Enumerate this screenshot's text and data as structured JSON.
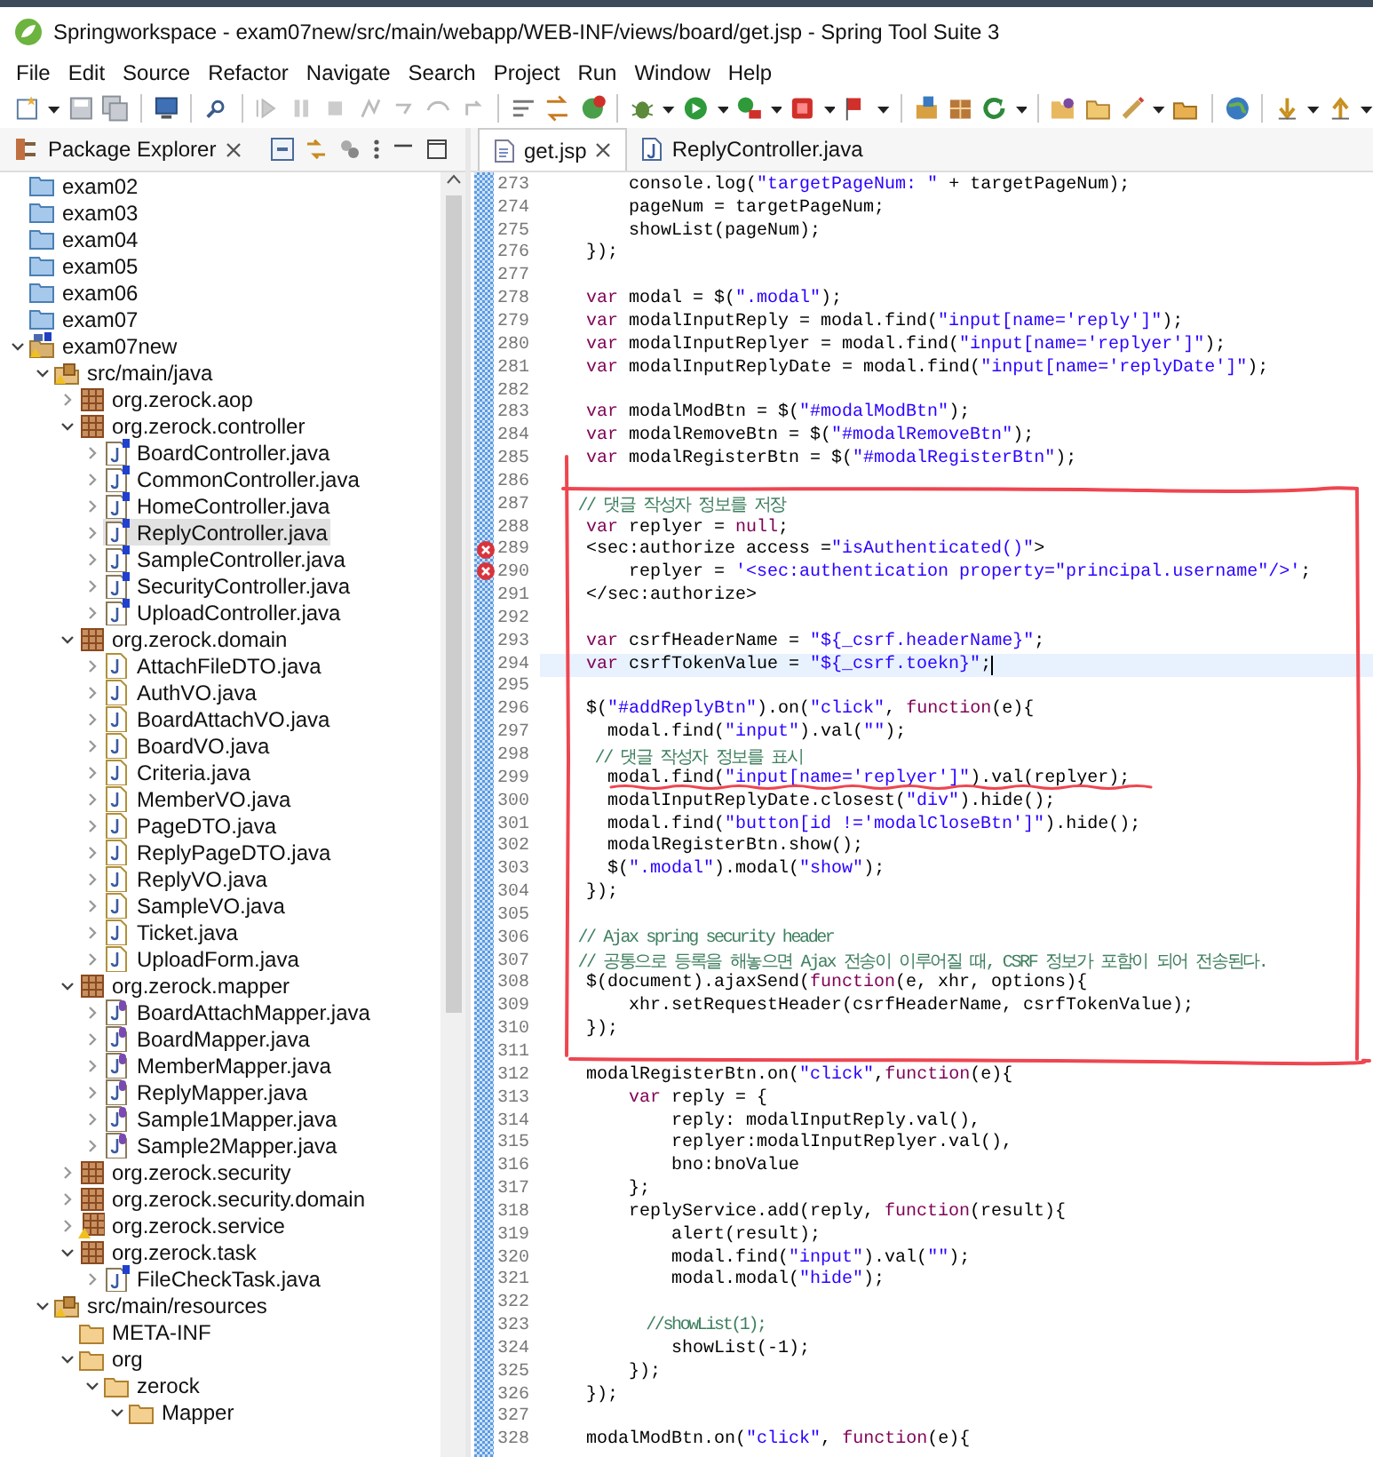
{
  "window": {
    "title": "Springworkspace - exam07new/src/main/webapp/WEB-INF/views/board/get.jsp - Spring Tool Suite 3"
  },
  "menu": [
    "File",
    "Edit",
    "Source",
    "Refactor",
    "Navigate",
    "Search",
    "Project",
    "Run",
    "Window",
    "Help"
  ],
  "explorer": {
    "title": "Package Explorer",
    "items": [
      {
        "label": "exam02",
        "kind": "project",
        "selected": false
      },
      {
        "label": "exam03",
        "kind": "project",
        "selected": false
      },
      {
        "label": "exam04",
        "kind": "project",
        "selected": false
      },
      {
        "label": "exam05",
        "kind": "project",
        "selected": false
      },
      {
        "label": "exam06",
        "kind": "project",
        "selected": false
      },
      {
        "label": "exam07",
        "kind": "project",
        "selected": false
      },
      {
        "label": "exam07new",
        "kind": "spring-project",
        "selected": false,
        "expanded": true,
        "children": [
          {
            "label": "src/main/java",
            "kind": "source-folder",
            "selected": false,
            "expanded": true,
            "children": [
              {
                "label": "org.zerock.aop",
                "kind": "package",
                "selected": false,
                "expanded": false
              },
              {
                "label": "org.zerock.controller",
                "kind": "package",
                "selected": false,
                "expanded": true,
                "children": [
                  {
                    "label": "BoardController.java",
                    "kind": "spring-java",
                    "selected": false,
                    "expanded": false
                  },
                  {
                    "label": "CommonController.java",
                    "kind": "spring-java",
                    "selected": false,
                    "expanded": false
                  },
                  {
                    "label": "HomeController.java",
                    "kind": "spring-java",
                    "selected": false,
                    "expanded": false
                  },
                  {
                    "label": "ReplyController.java",
                    "kind": "spring-java",
                    "selected": true,
                    "expanded": false
                  },
                  {
                    "label": "SampleController.java",
                    "kind": "spring-java",
                    "selected": false,
                    "expanded": false
                  },
                  {
                    "label": "SecurityController.java",
                    "kind": "spring-java",
                    "selected": false,
                    "expanded": false
                  },
                  {
                    "label": "UploadController.java",
                    "kind": "spring-java",
                    "selected": false,
                    "expanded": false
                  }
                ]
              },
              {
                "label": "org.zerock.domain",
                "kind": "package",
                "selected": false,
                "expanded": true,
                "children": [
                  {
                    "label": "AttachFileDTO.java",
                    "kind": "java",
                    "selected": false,
                    "expanded": false
                  },
                  {
                    "label": "AuthVO.java",
                    "kind": "java",
                    "selected": false,
                    "expanded": false
                  },
                  {
                    "label": "BoardAttachVO.java",
                    "kind": "java",
                    "selected": false,
                    "expanded": false
                  },
                  {
                    "label": "BoardVO.java",
                    "kind": "java",
                    "selected": false,
                    "expanded": false
                  },
                  {
                    "label": "Criteria.java",
                    "kind": "java",
                    "selected": false,
                    "expanded": false
                  },
                  {
                    "label": "MemberVO.java",
                    "kind": "java",
                    "selected": false,
                    "expanded": false
                  },
                  {
                    "label": "PageDTO.java",
                    "kind": "java",
                    "selected": false,
                    "expanded": false
                  },
                  {
                    "label": "ReplyPageDTO.java",
                    "kind": "java",
                    "selected": false,
                    "expanded": false
                  },
                  {
                    "label": "ReplyVO.java",
                    "kind": "java",
                    "selected": false,
                    "expanded": false
                  },
                  {
                    "label": "SampleVO.java",
                    "kind": "java",
                    "selected": false,
                    "expanded": false
                  },
                  {
                    "label": "Ticket.java",
                    "kind": "java",
                    "selected": false,
                    "expanded": false
                  },
                  {
                    "label": "UploadForm.java",
                    "kind": "java",
                    "selected": false,
                    "expanded": false
                  }
                ]
              },
              {
                "label": "org.zerock.mapper",
                "kind": "package",
                "selected": false,
                "expanded": true,
                "children": [
                  {
                    "label": "BoardAttachMapper.java",
                    "kind": "interface",
                    "selected": false,
                    "expanded": false
                  },
                  {
                    "label": "BoardMapper.java",
                    "kind": "interface",
                    "selected": false,
                    "expanded": false
                  },
                  {
                    "label": "MemberMapper.java",
                    "kind": "interface",
                    "selected": false,
                    "expanded": false
                  },
                  {
                    "label": "ReplyMapper.java",
                    "kind": "interface",
                    "selected": false,
                    "expanded": false
                  },
                  {
                    "label": "Sample1Mapper.java",
                    "kind": "interface",
                    "selected": false,
                    "expanded": false
                  },
                  {
                    "label": "Sample2Mapper.java",
                    "kind": "interface",
                    "selected": false,
                    "expanded": false
                  }
                ]
              },
              {
                "label": "org.zerock.security",
                "kind": "package",
                "selected": false,
                "expanded": false
              },
              {
                "label": "org.zerock.security.domain",
                "kind": "package",
                "selected": false,
                "expanded": false
              },
              {
                "label": "org.zerock.service",
                "kind": "package-warning",
                "selected": false,
                "expanded": false
              },
              {
                "label": "org.zerock.task",
                "kind": "package",
                "selected": false,
                "expanded": true,
                "children": [
                  {
                    "label": "FileCheckTask.java",
                    "kind": "spring-java",
                    "selected": false,
                    "expanded": false
                  }
                ]
              }
            ]
          },
          {
            "label": "src/main/resources",
            "kind": "source-folder",
            "selected": false,
            "expanded": true,
            "children": [
              {
                "label": "META-INF",
                "kind": "folder",
                "selected": false
              },
              {
                "label": "org",
                "kind": "folder",
                "selected": false,
                "expanded": true,
                "children": [
                  {
                    "label": "zerock",
                    "kind": "folder",
                    "selected": false,
                    "expanded": true,
                    "children": [
                      {
                        "label": "Mapper",
                        "kind": "folder",
                        "selected": false,
                        "expanded": true
                      }
                    ]
                  }
                ]
              }
            ]
          }
        ]
      }
    ]
  },
  "editor": {
    "tabs": [
      {
        "label": "get.jsp",
        "kind": "jsp",
        "selected": true
      },
      {
        "label": "ReplyController.java",
        "kind": "java",
        "selected": false
      }
    ],
    "lines": [
      {
        "number": "273",
        "tokens": [
          {
            "kind": "plain",
            "text": "        console.log("
          },
          {
            "kind": "string",
            "text": "\"targetPageNum: \""
          },
          {
            "kind": "plain",
            "text": " + targetPageNum);"
          }
        ]
      },
      {
        "number": "274",
        "tokens": [
          {
            "kind": "plain",
            "text": "        pageNum = targetPageNum;"
          }
        ]
      },
      {
        "number": "275",
        "tokens": [
          {
            "kind": "plain",
            "text": "        showList(pageNum);"
          }
        ]
      },
      {
        "number": "276",
        "tokens": [
          {
            "kind": "plain",
            "text": "    });"
          }
        ]
      },
      {
        "number": "277"
      },
      {
        "number": "278",
        "tokens": [
          {
            "kind": "keyword",
            "text": "    var"
          },
          {
            "kind": "plain",
            "text": " modal = $("
          },
          {
            "kind": "string",
            "text": "\".modal\""
          },
          {
            "kind": "plain",
            "text": ");"
          }
        ]
      },
      {
        "number": "279",
        "tokens": [
          {
            "kind": "keyword",
            "text": "    var"
          },
          {
            "kind": "plain",
            "text": " modalInputReply = modal.find("
          },
          {
            "kind": "string",
            "text": "\"input[name='reply']\""
          },
          {
            "kind": "plain",
            "text": ");"
          }
        ]
      },
      {
        "number": "280",
        "tokens": [
          {
            "kind": "keyword",
            "text": "    var"
          },
          {
            "kind": "plain",
            "text": " modalInputReplyer = modal.find("
          },
          {
            "kind": "string",
            "text": "\"input[name='replyer']\""
          },
          {
            "kind": "plain",
            "text": ");"
          }
        ]
      },
      {
        "number": "281",
        "tokens": [
          {
            "kind": "keyword",
            "text": "    var"
          },
          {
            "kind": "plain",
            "text": " modalInputReplyDate = modal.find("
          },
          {
            "kind": "string",
            "text": "\"input[name='replyDate']\""
          },
          {
            "kind": "plain",
            "text": ");"
          }
        ]
      },
      {
        "number": "282"
      },
      {
        "number": "283",
        "tokens": [
          {
            "kind": "keyword",
            "text": "    var"
          },
          {
            "kind": "plain",
            "text": " modalModBtn = $("
          },
          {
            "kind": "string",
            "text": "\"#modalModBtn\""
          },
          {
            "kind": "plain",
            "text": ");"
          }
        ]
      },
      {
        "number": "284",
        "tokens": [
          {
            "kind": "keyword",
            "text": "    var"
          },
          {
            "kind": "plain",
            "text": " modalRemoveBtn = $("
          },
          {
            "kind": "string",
            "text": "\"#modalRemoveBtn\""
          },
          {
            "kind": "plain",
            "text": ");"
          }
        ]
      },
      {
        "number": "285",
        "tokens": [
          {
            "kind": "keyword",
            "text": "    var"
          },
          {
            "kind": "plain",
            "text": " modalRegisterBtn = $("
          },
          {
            "kind": "string",
            "text": "\"#modalRegisterBtn\""
          },
          {
            "kind": "plain",
            "text": ");"
          }
        ]
      },
      {
        "number": "286"
      },
      {
        "number": "287",
        "tokens": [
          {
            "kind": "comment",
            "text": "    // 댓글 작성자 정보를 저장"
          }
        ]
      },
      {
        "number": "288",
        "tokens": [
          {
            "kind": "keyword",
            "text": "    var"
          },
          {
            "kind": "plain",
            "text": " replyer = "
          },
          {
            "kind": "keyword",
            "text": "null"
          },
          {
            "kind": "plain",
            "text": ";"
          }
        ]
      },
      {
        "number": "289",
        "error": true,
        "tokens": [
          {
            "kind": "plain",
            "text": "    <sec:authorize access ="
          },
          {
            "kind": "string",
            "text": "\"isAuthenticated()\""
          },
          {
            "kind": "plain",
            "text": ">"
          }
        ]
      },
      {
        "number": "290",
        "error": true,
        "tokens": [
          {
            "kind": "plain",
            "text": "        replyer = "
          },
          {
            "kind": "string",
            "text": "'<sec:authentication property=\"principal.username\"/>'"
          },
          {
            "kind": "plain",
            "text": ";"
          }
        ]
      },
      {
        "number": "291",
        "tokens": [
          {
            "kind": "plain",
            "text": "    </sec:authorize>"
          }
        ]
      },
      {
        "number": "292"
      },
      {
        "number": "293",
        "tokens": [
          {
            "kind": "keyword",
            "text": "    var"
          },
          {
            "kind": "plain",
            "text": " csrfHeaderName = "
          },
          {
            "kind": "string",
            "text": "\"${_csrf.headerName}\""
          },
          {
            "kind": "plain",
            "text": ";"
          }
        ]
      },
      {
        "number": "294",
        "current": true,
        "tokens": [
          {
            "kind": "keyword",
            "text": "    var"
          },
          {
            "kind": "plain",
            "text": " csrfTokenValue = "
          },
          {
            "kind": "string",
            "text": "\"${_csrf.toekn}\""
          },
          {
            "kind": "plain",
            "text": ";"
          }
        ]
      },
      {
        "number": "295"
      },
      {
        "number": "296",
        "tokens": [
          {
            "kind": "plain",
            "text": "    $("
          },
          {
            "kind": "string",
            "text": "\"#addReplyBtn\""
          },
          {
            "kind": "plain",
            "text": ").on("
          },
          {
            "kind": "string",
            "text": "\"click\""
          },
          {
            "kind": "plain",
            "text": ", "
          },
          {
            "kind": "keyword",
            "text": "function"
          },
          {
            "kind": "plain",
            "text": "(e){"
          }
        ]
      },
      {
        "number": "297",
        "tokens": [
          {
            "kind": "plain",
            "text": "      modal.find("
          },
          {
            "kind": "string",
            "text": "\"input\""
          },
          {
            "kind": "plain",
            "text": ").val("
          },
          {
            "kind": "string",
            "text": "\"\""
          },
          {
            "kind": "plain",
            "text": ");"
          }
        ]
      },
      {
        "number": "298",
        "tokens": [
          {
            "kind": "comment",
            "text": "      // 댓글 작성자 정보를 표시"
          }
        ]
      },
      {
        "number": "299",
        "tokens": [
          {
            "kind": "plain",
            "text": "      modal.find("
          },
          {
            "kind": "string",
            "text": "\"input[name='replyer']\""
          },
          {
            "kind": "plain",
            "text": ").val(replyer);"
          }
        ]
      },
      {
        "number": "300",
        "tokens": [
          {
            "kind": "plain",
            "text": "      modalInputReplyDate.closest("
          },
          {
            "kind": "string",
            "text": "\"div\""
          },
          {
            "kind": "plain",
            "text": ").hide();"
          }
        ]
      },
      {
        "number": "301",
        "tokens": [
          {
            "kind": "plain",
            "text": "      modal.find("
          },
          {
            "kind": "string",
            "text": "\"button[id !='modalCloseBtn']\""
          },
          {
            "kind": "plain",
            "text": ").hide();"
          }
        ]
      },
      {
        "number": "302",
        "tokens": [
          {
            "kind": "plain",
            "text": "      modalRegisterBtn.show();"
          }
        ]
      },
      {
        "number": "303",
        "tokens": [
          {
            "kind": "plain",
            "text": "      $("
          },
          {
            "kind": "string",
            "text": "\".modal\""
          },
          {
            "kind": "plain",
            "text": ").modal("
          },
          {
            "kind": "string",
            "text": "\"show\""
          },
          {
            "kind": "plain",
            "text": ");"
          }
        ]
      },
      {
        "number": "304",
        "tokens": [
          {
            "kind": "plain",
            "text": "    });"
          }
        ]
      },
      {
        "number": "305"
      },
      {
        "number": "306",
        "tokens": [
          {
            "kind": "comment",
            "text": "    // Ajax spring security header"
          }
        ]
      },
      {
        "number": "307",
        "tokens": [
          {
            "kind": "comment",
            "text": "    // 공통으로 등록을 해놓으면 Ajax 전송이 이루어질 때, CSRF 정보가 포함이 되어 전송된다."
          }
        ]
      },
      {
        "number": "308",
        "tokens": [
          {
            "kind": "plain",
            "text": "    $(document).ajaxSend("
          },
          {
            "kind": "keyword",
            "text": "function"
          },
          {
            "kind": "plain",
            "text": "(e, xhr, options){"
          }
        ]
      },
      {
        "number": "309",
        "tokens": [
          {
            "kind": "plain",
            "text": "        xhr.setRequestHeader(csrfHeaderName, csrfTokenValue);"
          }
        ]
      },
      {
        "number": "310",
        "tokens": [
          {
            "kind": "plain",
            "text": "    });"
          }
        ]
      },
      {
        "number": "311"
      },
      {
        "number": "312",
        "tokens": [
          {
            "kind": "plain",
            "text": "    modalRegisterBtn.on("
          },
          {
            "kind": "string",
            "text": "\"click\""
          },
          {
            "kind": "plain",
            "text": ","
          },
          {
            "kind": "keyword",
            "text": "function"
          },
          {
            "kind": "plain",
            "text": "(e){"
          }
        ]
      },
      {
        "number": "313",
        "tokens": [
          {
            "kind": "keyword",
            "text": "        var"
          },
          {
            "kind": "plain",
            "text": " reply = {"
          }
        ]
      },
      {
        "number": "314",
        "tokens": [
          {
            "kind": "plain",
            "text": "            reply: modalInputReply.val(),"
          }
        ]
      },
      {
        "number": "315",
        "tokens": [
          {
            "kind": "plain",
            "text": "            replyer:modalInputReplyer.val(),"
          }
        ]
      },
      {
        "number": "316",
        "tokens": [
          {
            "kind": "plain",
            "text": "            bno:bnoValue"
          }
        ]
      },
      {
        "number": "317",
        "tokens": [
          {
            "kind": "plain",
            "text": "        };"
          }
        ]
      },
      {
        "number": "318",
        "tokens": [
          {
            "kind": "plain",
            "text": "        replyService.add(reply, "
          },
          {
            "kind": "keyword",
            "text": "function"
          },
          {
            "kind": "plain",
            "text": "(result){"
          }
        ]
      },
      {
        "number": "319",
        "tokens": [
          {
            "kind": "plain",
            "text": "            alert(result);"
          }
        ]
      },
      {
        "number": "320",
        "tokens": [
          {
            "kind": "plain",
            "text": "            modal.find("
          },
          {
            "kind": "string",
            "text": "\"input\""
          },
          {
            "kind": "plain",
            "text": ").val("
          },
          {
            "kind": "string",
            "text": "\"\""
          },
          {
            "kind": "plain",
            "text": ");"
          }
        ]
      },
      {
        "number": "321",
        "tokens": [
          {
            "kind": "plain",
            "text": "            modal.modal("
          },
          {
            "kind": "string",
            "text": "\"hide\""
          },
          {
            "kind": "plain",
            "text": ");"
          }
        ]
      },
      {
        "number": "322"
      },
      {
        "number": "323",
        "tokens": [
          {
            "kind": "comment",
            "text": "            //showList(1);"
          }
        ]
      },
      {
        "number": "324",
        "tokens": [
          {
            "kind": "plain",
            "text": "            showList(-1);"
          }
        ]
      },
      {
        "number": "325",
        "tokens": [
          {
            "kind": "plain",
            "text": "        });"
          }
        ]
      },
      {
        "number": "326",
        "tokens": [
          {
            "kind": "plain",
            "text": "    });"
          }
        ]
      },
      {
        "number": "327"
      },
      {
        "number": "328",
        "tokens": [
          {
            "kind": "plain",
            "text": "    modalModBtn.on("
          },
          {
            "kind": "string",
            "text": "\"click\""
          },
          {
            "kind": "plain",
            "text": ", "
          },
          {
            "kind": "keyword",
            "text": "function"
          },
          {
            "kind": "plain",
            "text": "(e){"
          }
        ]
      }
    ]
  }
}
